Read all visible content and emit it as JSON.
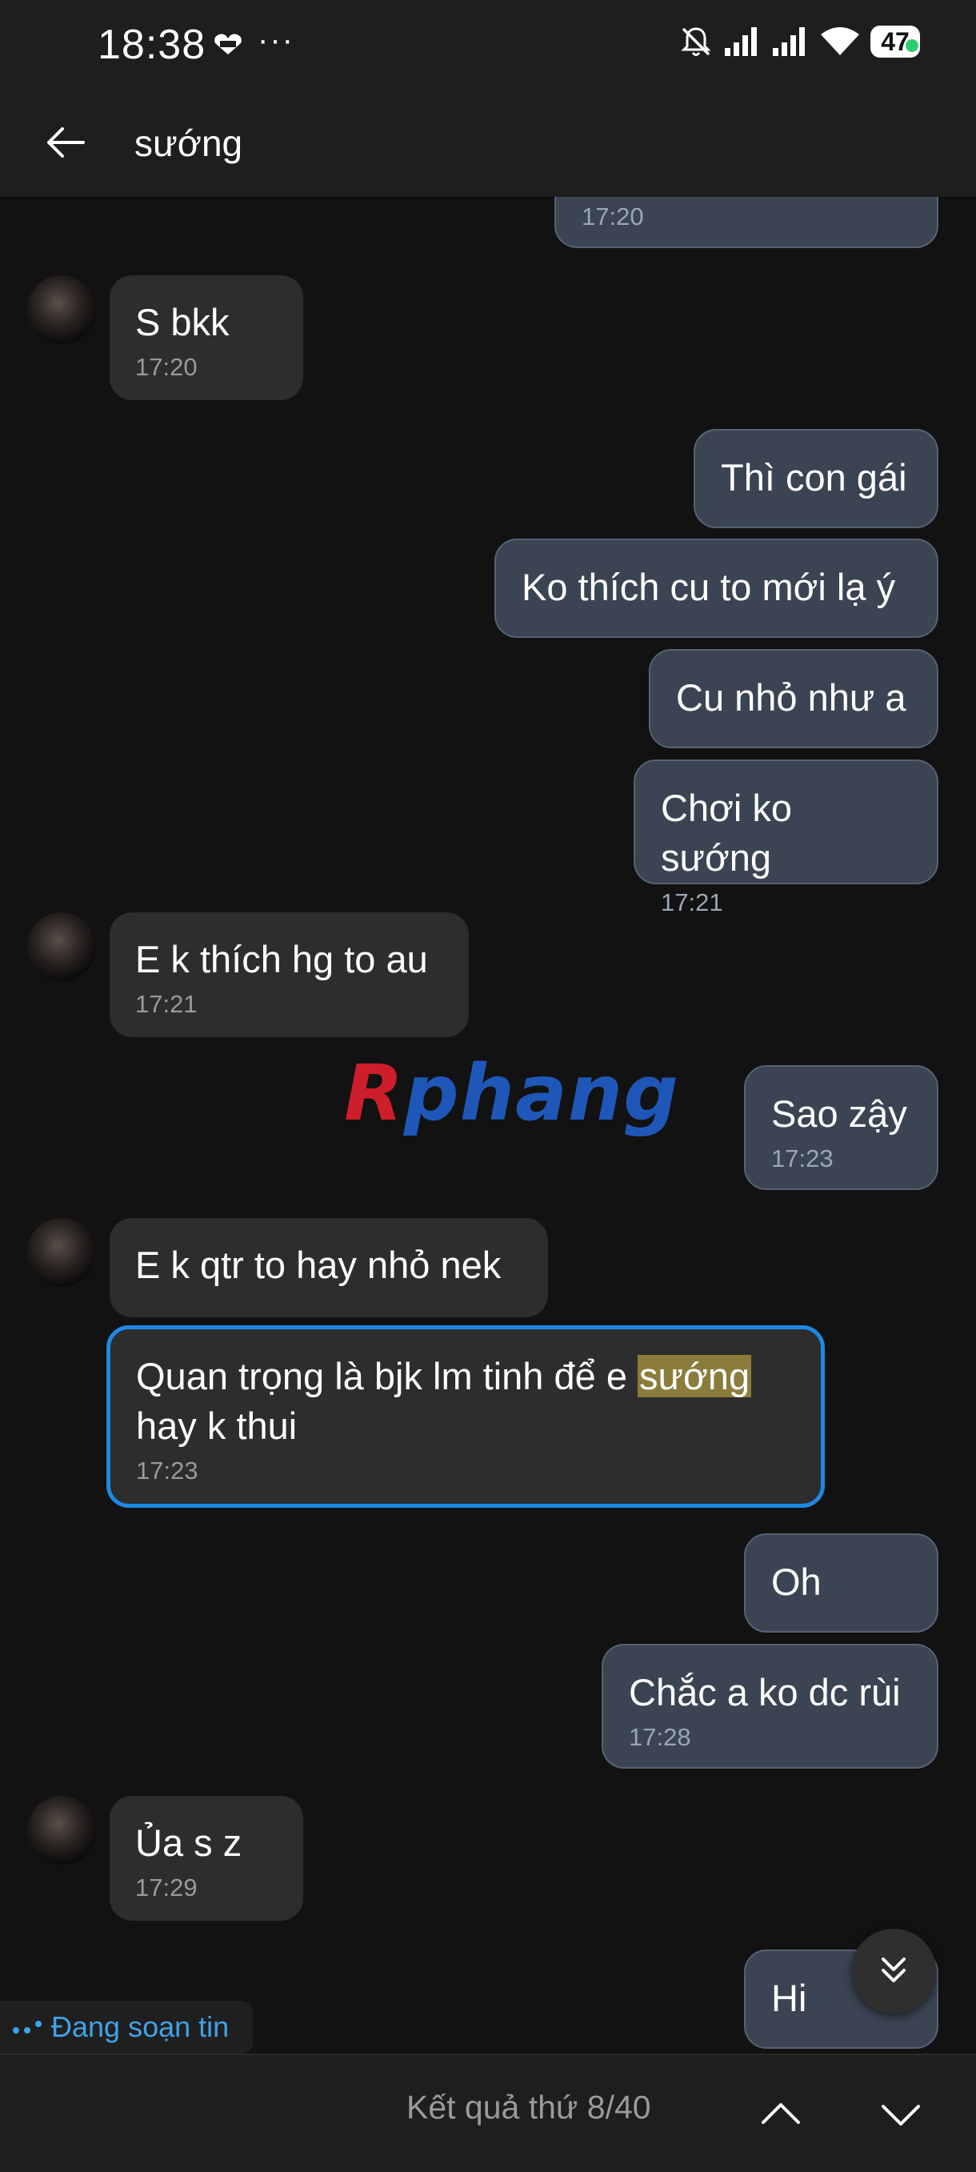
{
  "status_bar": {
    "time": "18:38",
    "more": "···",
    "battery": "47",
    "icons": [
      "lazada-icon",
      "mute-bell-icon",
      "signal-icon",
      "signal-icon",
      "wifi-icon",
      "battery-icon"
    ]
  },
  "header": {
    "title": "sướng"
  },
  "messages": [
    {
      "side": "out",
      "text": "",
      "time": "17:20"
    },
    {
      "side": "in",
      "text": "S bkk",
      "time": "17:20"
    },
    {
      "side": "out",
      "text": "Thì con gái",
      "time": ""
    },
    {
      "side": "out",
      "text": "Ko thích cu to mới lạ ý",
      "time": ""
    },
    {
      "side": "out",
      "text": "Cu nhỏ như a",
      "time": ""
    },
    {
      "side": "out",
      "text": "Chơi ko sướng",
      "time": "17:21"
    },
    {
      "side": "in",
      "text": "E k thích hg to au",
      "time": "17:21"
    },
    {
      "side": "out",
      "text": "Sao zậy",
      "time": "17:23"
    },
    {
      "side": "in",
      "text": "E k qtr to hay nhỏ nek",
      "time": ""
    },
    {
      "side": "in",
      "text_before": "Quan trọng là bjk lm tinh để e ",
      "highlight": "sướng",
      "text_after": "hay k thui",
      "time": "17:23"
    },
    {
      "side": "out",
      "text": "Oh",
      "time": ""
    },
    {
      "side": "out",
      "text": "Chắc a ko dc rùi",
      "time": "17:28"
    },
    {
      "side": "in",
      "text": "Ủa s z",
      "time": "17:29"
    },
    {
      "side": "out",
      "text": "Hi",
      "time": ""
    }
  ],
  "watermark": {
    "part1": "R",
    "part2": "phang"
  },
  "typing_indicator": {
    "label": "Đang soạn tin"
  },
  "search_nav": {
    "result_text": "Kết quả thứ 8/40"
  },
  "colors": {
    "accent": "#1e88e5",
    "highlight": "#8a7c3a",
    "outgoing": "#3a4452",
    "incoming": "#2d2d2d"
  }
}
